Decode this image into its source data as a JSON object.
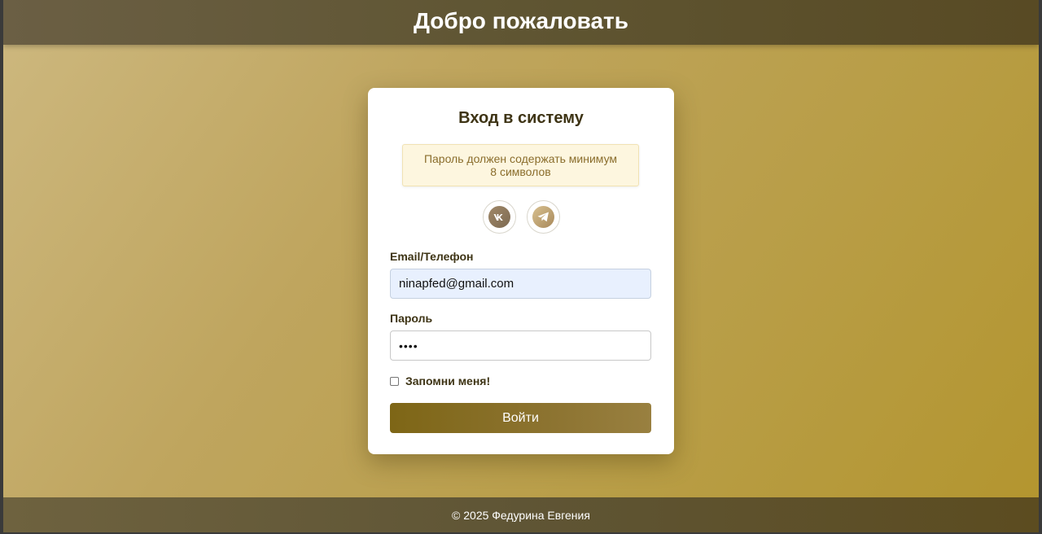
{
  "header": {
    "title": "Добро пожаловать"
  },
  "login": {
    "title": "Вход в систему",
    "notice": "Пароль должен содержать минимум 8 символов",
    "social": [
      {
        "name": "vk-icon"
      },
      {
        "name": "telegram-icon"
      }
    ],
    "email_label": "Email/Телефон",
    "email_value": "ninapfed@gmail.com",
    "password_label": "Пароль",
    "password_value": "••••",
    "remember_label": "Запомни меня!",
    "remember_checked": false,
    "submit_label": "Войти"
  },
  "footer": {
    "text": "© 2025 Федурина Евгения"
  },
  "colors": {
    "accent": "#7e6616",
    "header_bg": "#5f5532",
    "text_dark": "#3e3415",
    "notice_bg": "#fdf6df",
    "notice_text": "#8a6d2c"
  }
}
